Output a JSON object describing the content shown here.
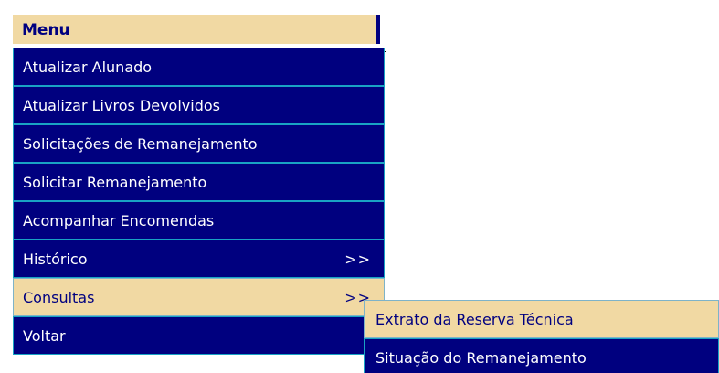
{
  "menu": {
    "title": "Menu",
    "items": [
      {
        "label": "Atualizar Alunado",
        "arrow": ""
      },
      {
        "label": "Atualizar Livros Devolvidos",
        "arrow": ""
      },
      {
        "label": "Solicitações de Remanejamento",
        "arrow": ""
      },
      {
        "label": "Solicitar Remanejamento",
        "arrow": ""
      },
      {
        "label": "Acompanhar Encomendas",
        "arrow": ""
      },
      {
        "label": "Histórico",
        "arrow": ">>"
      },
      {
        "label": "Consultas",
        "arrow": ">>"
      },
      {
        "label": "Voltar",
        "arrow": ""
      }
    ]
  },
  "submenu": {
    "items": [
      {
        "label": "Extrato da Reserva Técnica"
      },
      {
        "label": "Situação do Remanejamento"
      }
    ]
  },
  "colors": {
    "menu_bg": "#00007f",
    "highlight_bg": "#f1d9a3",
    "border": "#19a3c4",
    "highlight_text": "#000080"
  }
}
